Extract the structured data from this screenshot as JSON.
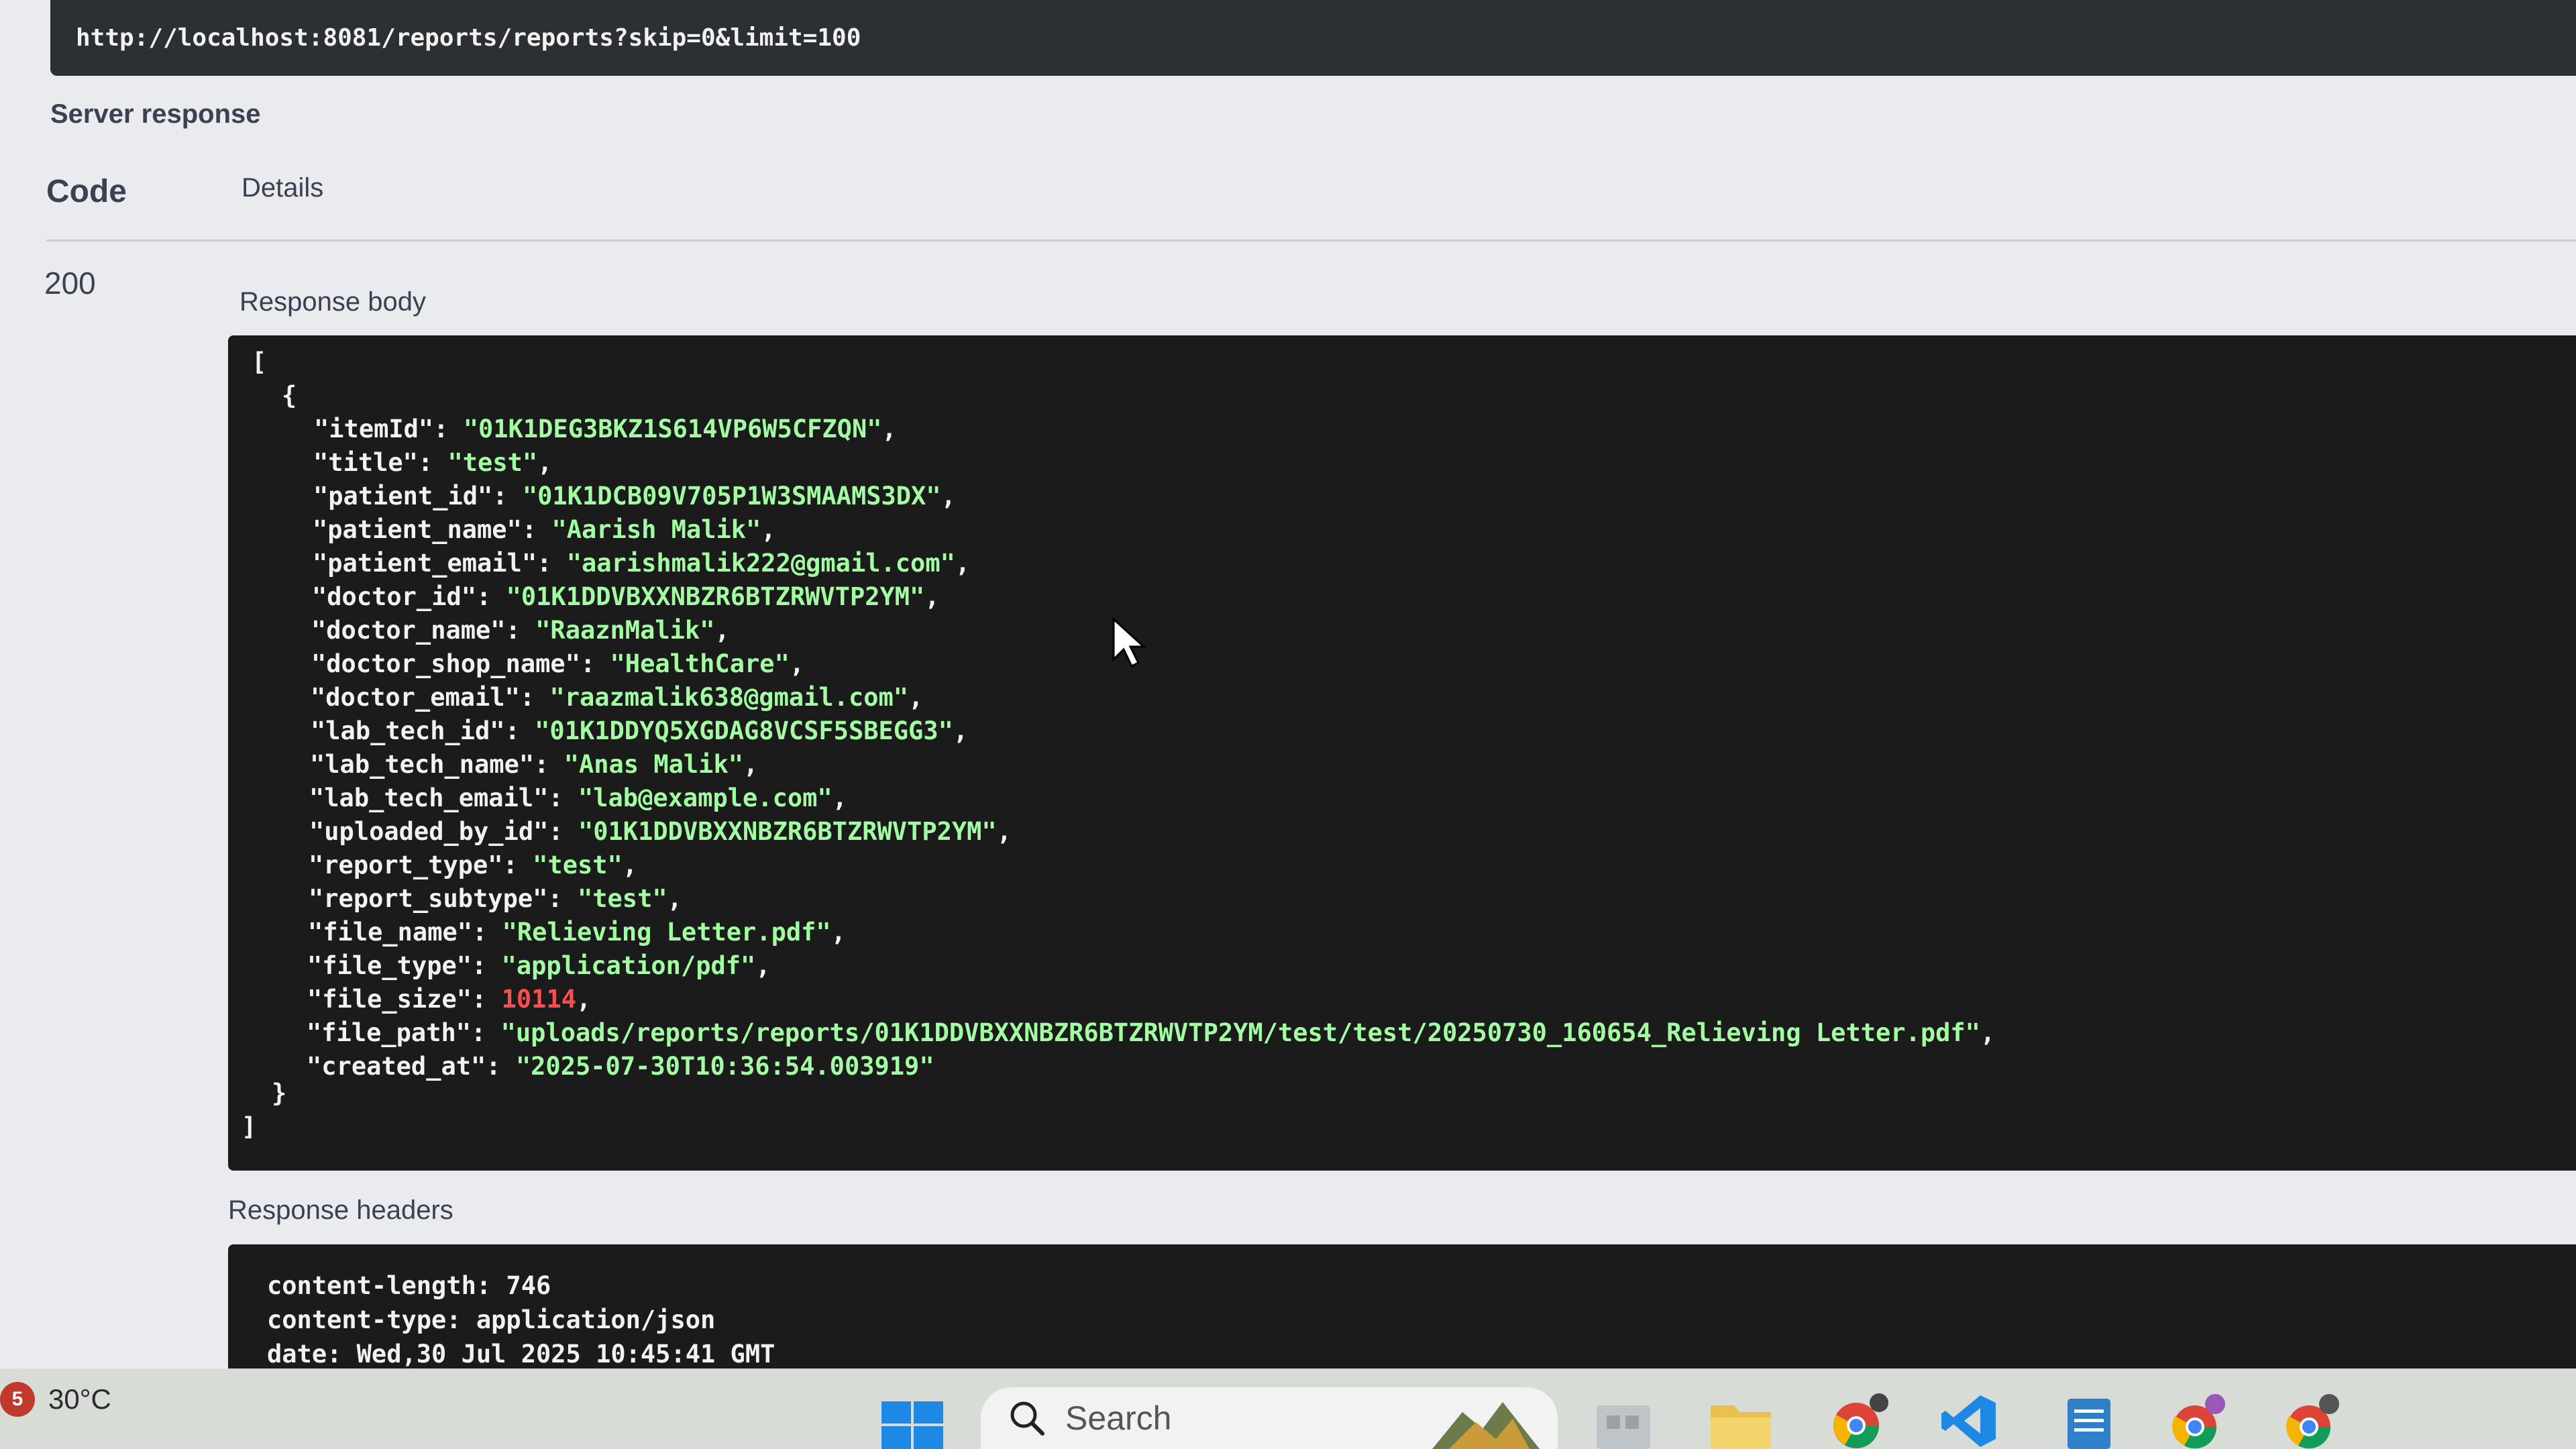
{
  "request_url": "http://localhost:8081/reports/reports?skip=0&limit=100",
  "server_response_label": "Server response",
  "table_headers": {
    "code": "Code",
    "details": "Details"
  },
  "status_code": "200",
  "response_body_label": "Response body",
  "response_body": {
    "open_bracket": "[",
    "open_brace": "{",
    "fields": [
      {
        "key": "\"itemId\"",
        "value": "\"01K1DEG3BKZ1S614VP6W5CFZQN\"",
        "type": "string"
      },
      {
        "key": "\"title\"",
        "value": "\"test\"",
        "type": "string"
      },
      {
        "key": "\"patient_id\"",
        "value": "\"01K1DCB09V705P1W3SMAAMS3DX\"",
        "type": "string"
      },
      {
        "key": "\"patient_name\"",
        "value": "\"Aarish Malik\"",
        "type": "string"
      },
      {
        "key": "\"patient_email\"",
        "value": "\"aarishmalik222@gmail.com\"",
        "type": "string"
      },
      {
        "key": "\"doctor_id\"",
        "value": "\"01K1DDVBXXNBZR6BTZRWVTP2YM\"",
        "type": "string"
      },
      {
        "key": "\"doctor_name\"",
        "value": "\"RaaznMalik\"",
        "type": "string"
      },
      {
        "key": "\"doctor_shop_name\"",
        "value": "\"HealthCare\"",
        "type": "string"
      },
      {
        "key": "\"doctor_email\"",
        "value": "\"raazmalik638@gmail.com\"",
        "type": "string"
      },
      {
        "key": "\"lab_tech_id\"",
        "value": "\"01K1DDYQ5XGDAG8VCSF5SBEGG3\"",
        "type": "string"
      },
      {
        "key": "\"lab_tech_name\"",
        "value": "\"Anas Malik\"",
        "type": "string"
      },
      {
        "key": "\"lab_tech_email\"",
        "value": "\"lab@example.com\"",
        "type": "string"
      },
      {
        "key": "\"uploaded_by_id\"",
        "value": "\"01K1DDVBXXNBZR6BTZRWVTP2YM\"",
        "type": "string"
      },
      {
        "key": "\"report_type\"",
        "value": "\"test\"",
        "type": "string"
      },
      {
        "key": "\"report_subtype\"",
        "value": "\"test\"",
        "type": "string"
      },
      {
        "key": "\"file_name\"",
        "value": "\"Relieving Letter.pdf\"",
        "type": "string"
      },
      {
        "key": "\"file_type\"",
        "value": "\"application/pdf\"",
        "type": "string"
      },
      {
        "key": "\"file_size\"",
        "value": "10114",
        "type": "number"
      },
      {
        "key": "\"file_path\"",
        "value": "\"uploads/reports/reports/01K1DDVBXXNBZR6BTZRWVTP2YM/test/test/20250730_160654_Relieving Letter.pdf\"",
        "type": "string"
      },
      {
        "key": "\"created_at\"",
        "value": "\"2025-07-30T10:36:54.003919\"",
        "type": "string"
      }
    ],
    "close_brace": "}",
    "close_bracket": "]"
  },
  "response_headers_label": "Response headers",
  "response_headers": [
    "content-length: 746",
    "content-type: application/json",
    "date: Wed,30 Jul 2025 10:45:41 GMT"
  ],
  "taskbar": {
    "weather_badge": "5",
    "weather_temp": "30°C",
    "search_placeholder": "Search",
    "icons": [
      "windows-start-icon",
      "search-icon",
      "widgets-icon",
      "file-explorer-icon",
      "folder-icon",
      "chrome-icon",
      "vscode-icon",
      "notepad-icon",
      "chrome-profile-icon",
      "chrome-profile-icon"
    ]
  },
  "colors": {
    "string": "#a2fca2",
    "number": "#ff4d4d",
    "code_background": "#1b1b1b",
    "page_background": "#e9ebee"
  }
}
